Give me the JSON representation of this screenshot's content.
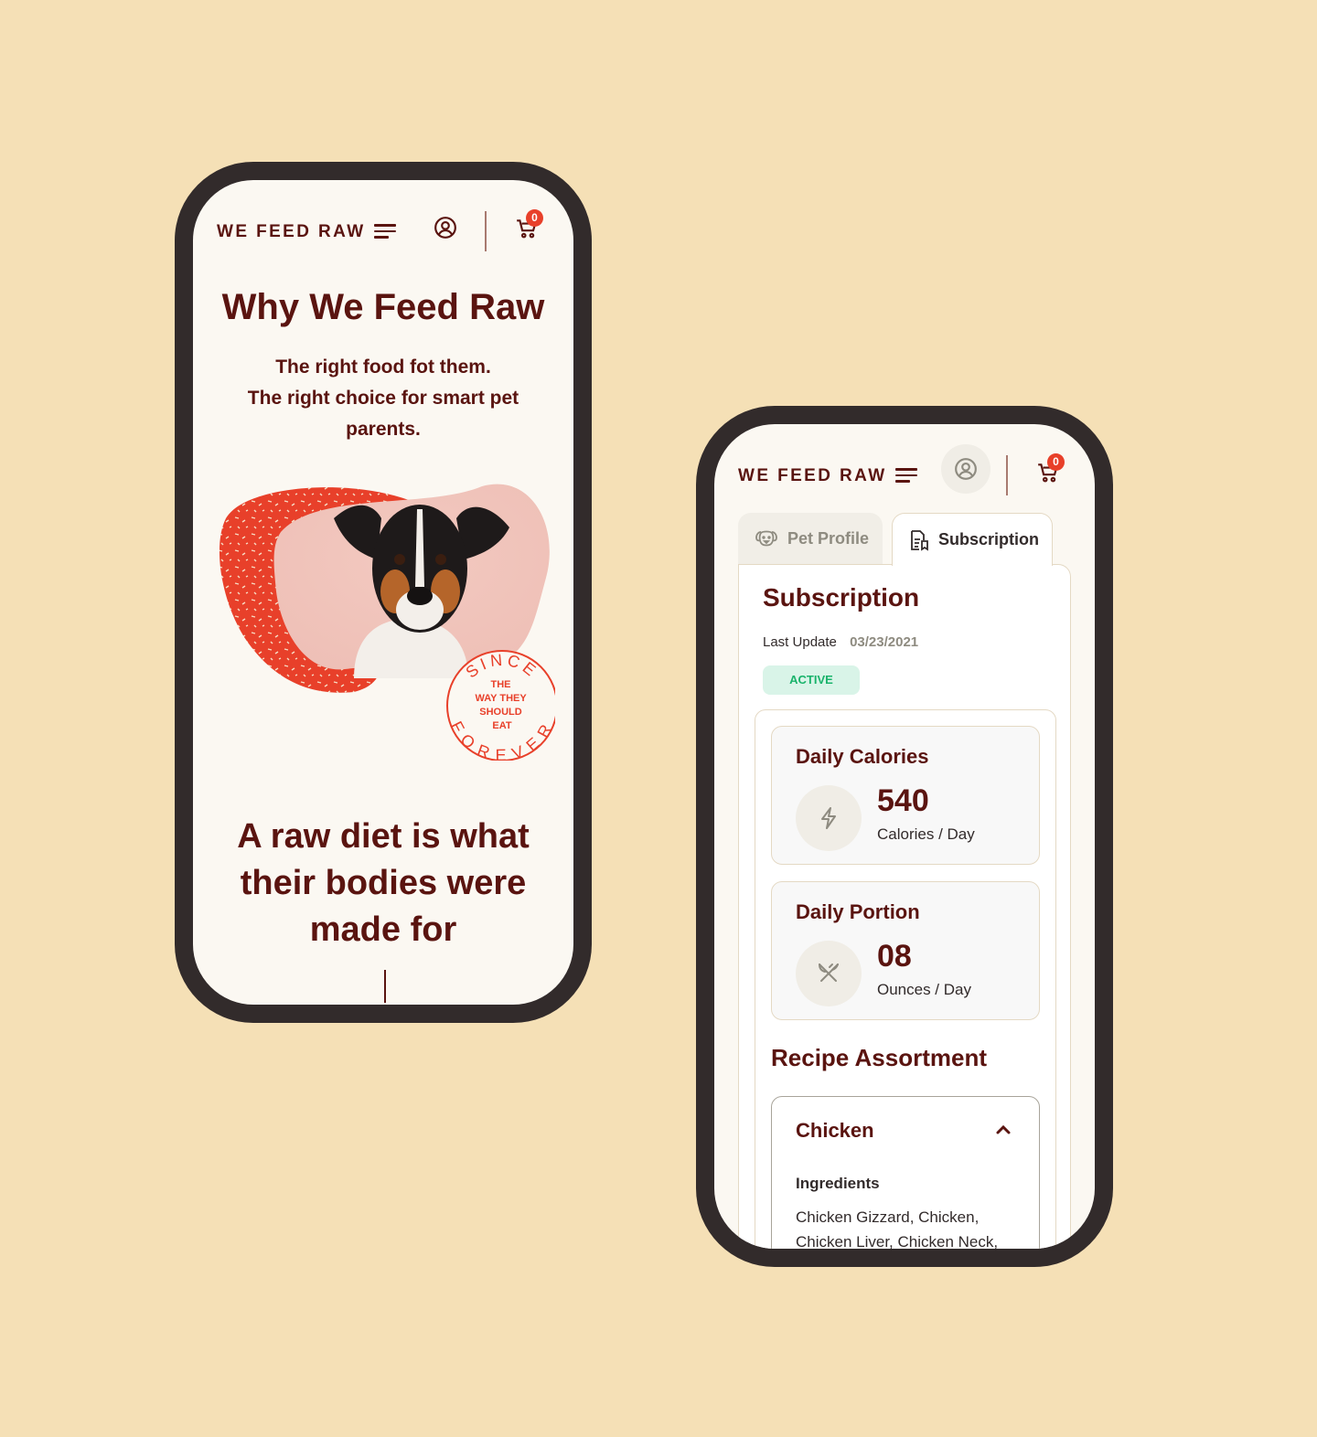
{
  "brand": {
    "logo": "WE FEED RAW",
    "cart_count": "0"
  },
  "colors": {
    "background": "#f5e0b6",
    "phone_frame": "#322b2b",
    "screen": "#fbf8f2",
    "brand_maroon": "#5a1410",
    "accent_red": "#e8402a",
    "active_green": "#19b36b",
    "active_green_bg": "#d9f4e8"
  },
  "phone1": {
    "title": "Why We Feed Raw",
    "subtitle_lines": [
      "The right food fot them.",
      "The right choice for smart pet",
      "parents."
    ],
    "stamp": {
      "ring_top": "SINCE",
      "ring_bottom": "FOREVER",
      "center_lines": [
        "THE",
        "WAY THEY",
        "SHOULD",
        "EAT"
      ]
    },
    "headline_lines": [
      "A raw diet is what",
      "their bodies were",
      "made for"
    ]
  },
  "phone2": {
    "tabs": [
      {
        "label": "Pet Profile",
        "icon": "dog-icon",
        "active": false
      },
      {
        "label": "Subscription",
        "icon": "document-icon",
        "active": true
      }
    ],
    "section_title": "Subscription",
    "last_update_label": "Last Update",
    "last_update_value": "03/23/2021",
    "status": "ACTIVE",
    "stats": [
      {
        "title": "Daily Calories",
        "icon": "lightning-icon",
        "value": "540",
        "unit": "Calories / Day"
      },
      {
        "title": "Daily Portion",
        "icon": "utensils-icon",
        "value": "08",
        "unit": "Ounces / Day"
      }
    ],
    "recipe_title": "Recipe Assortment",
    "recipe": {
      "name": "Chicken",
      "expanded": true,
      "ingredients_label": "Ingredients",
      "ingredients_text": "Chicken Gizzard, Chicken, Chicken Liver, Chicken Neck,"
    }
  }
}
